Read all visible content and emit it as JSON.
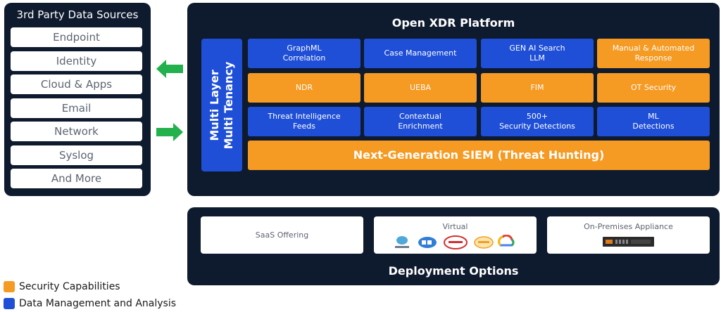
{
  "sources": {
    "title": "3rd Party Data Sources",
    "items": [
      "Endpoint",
      "Identity",
      "Cloud & Apps",
      "Email",
      "Network",
      "Syslog",
      "And More"
    ]
  },
  "platform": {
    "title": "Open XDR Platform",
    "tenancy_line1": "Multi Layer",
    "tenancy_line2": "Multi Tenancy",
    "capabilities": [
      {
        "label": "GraphML\nCorrelation",
        "kind": "data"
      },
      {
        "label": "Case Management",
        "kind": "data"
      },
      {
        "label": "GEN AI Search\nLLM",
        "kind": "data"
      },
      {
        "label": "Manual & Automated\nResponse",
        "kind": "security"
      },
      {
        "label": "NDR",
        "kind": "security"
      },
      {
        "label": "UEBA",
        "kind": "security"
      },
      {
        "label": "FIM",
        "kind": "security"
      },
      {
        "label": "OT Security",
        "kind": "security"
      },
      {
        "label": "Threat Intelligence\nFeeds",
        "kind": "data"
      },
      {
        "label": "Contextual\nEnrichment",
        "kind": "data"
      },
      {
        "label": "500+\nSecurity Detections",
        "kind": "data"
      },
      {
        "label": "ML\nDetections",
        "kind": "data"
      }
    ],
    "siem": "Next-Generation SIEM (Threat Hunting)"
  },
  "deployment": {
    "title": "Deployment Options",
    "saas": "SaaS Offering",
    "virtual": "Virtual",
    "onprem": "On-Premises Appliance",
    "virtual_logos": [
      "vmware-icon",
      "hyperv-icon",
      "oracle-cloud-icon",
      "aws-icon",
      "google-cloud-icon"
    ]
  },
  "legend": {
    "security": "Security Capabilities",
    "data": "Data Management and Analysis"
  },
  "colors": {
    "panel": "#0e1a2e",
    "blue": "#1f4fd6",
    "orange": "#f59a23",
    "arrow": "#22b14c"
  }
}
